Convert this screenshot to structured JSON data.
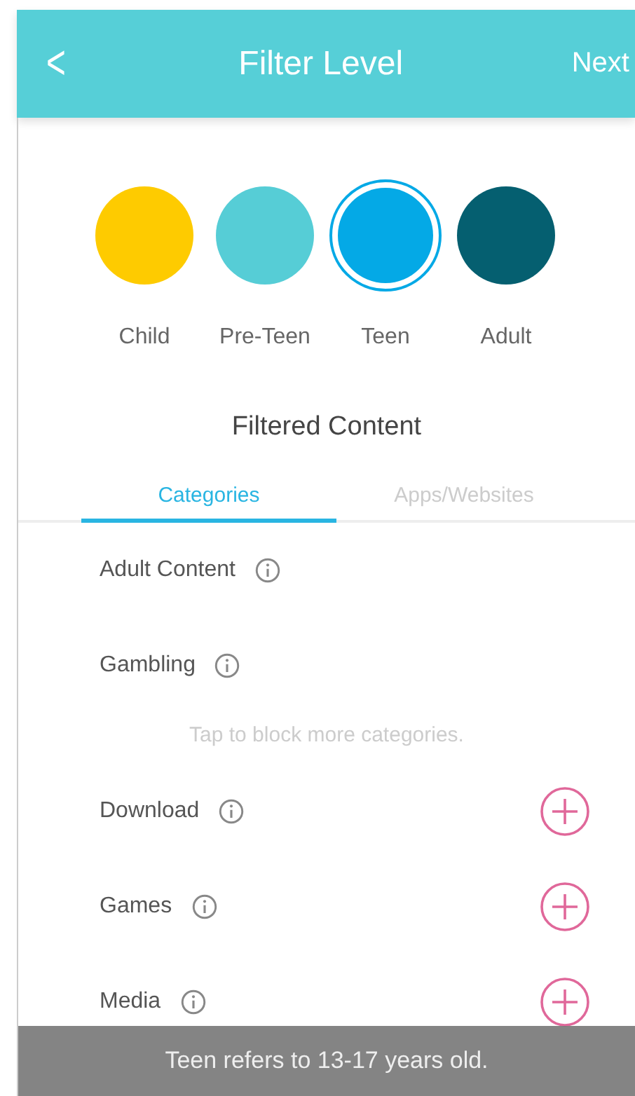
{
  "header": {
    "back": "<",
    "title": "Filter Level",
    "next": "Next"
  },
  "levels": [
    {
      "label": "Child",
      "color": "#fecb00",
      "selected": false
    },
    {
      "label": "Pre-Teen",
      "color": "#56cdd6",
      "selected": false
    },
    {
      "label": "Teen",
      "color": "#04a9e6",
      "selected": true
    },
    {
      "label": "Adult",
      "color": "#055f70",
      "selected": false
    }
  ],
  "section_title": "Filtered Content",
  "tabs": [
    {
      "label": "Categories",
      "selected": true
    },
    {
      "label": "Apps/Websites",
      "selected": false
    }
  ],
  "blocked": [
    {
      "name": "Adult Content"
    },
    {
      "name": "Gambling"
    }
  ],
  "hint": "Tap to block more categories.",
  "available": [
    {
      "name": "Download"
    },
    {
      "name": "Games"
    },
    {
      "name": "Media"
    }
  ],
  "toast": "Teen refers to 13-17 years old."
}
